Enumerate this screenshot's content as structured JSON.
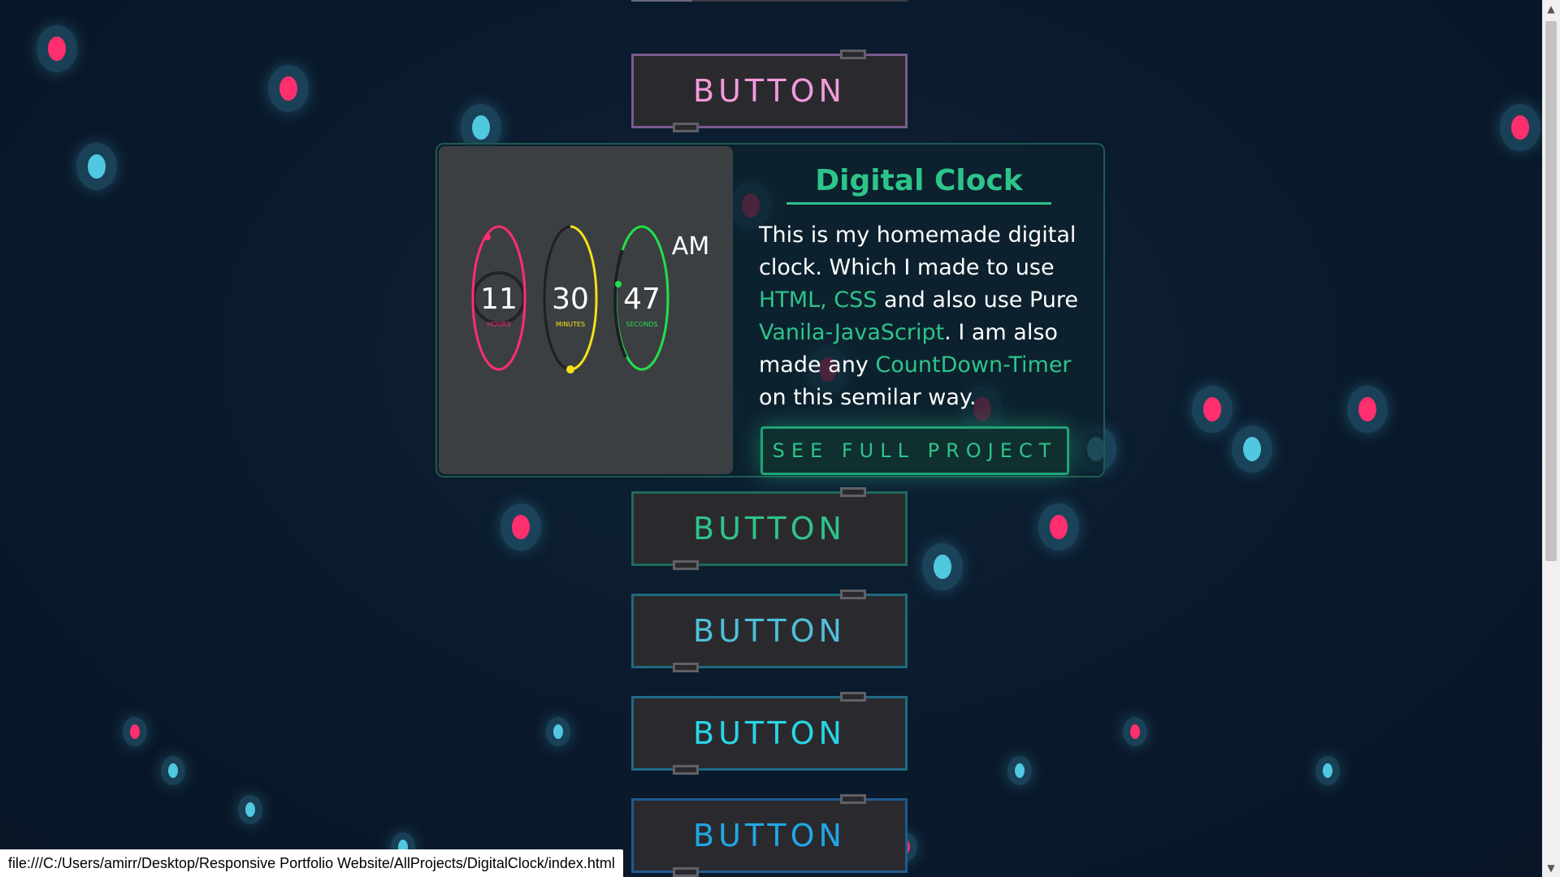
{
  "buttons": [
    {
      "label": "BUTTON"
    },
    {
      "label": "BUTTON"
    },
    {
      "label": "BUTTON"
    },
    {
      "label": "BUTTON"
    },
    {
      "label": "BUTTON"
    }
  ],
  "project": {
    "title": "Digital Clock",
    "desc": {
      "t1": "This is my homemade digital clock. Which I made to use ",
      "h1": "HTML, CSS",
      "t2": " and also use Pure ",
      "h2": "Vanila-JavaScript",
      "t3": ". I am also made any ",
      "h3": "CountDown-Timer",
      "t4": " on this semilar way."
    },
    "cta": "SEE FULL PROJECT",
    "clock": {
      "hours": "11",
      "hours_label": "HOURS",
      "minutes": "30",
      "minutes_label": "MINUTES",
      "seconds": "47",
      "seconds_label": "SECONDS",
      "period": "AM",
      "colors": {
        "hours": "#ff2e6e",
        "minutes": "#f6e21a",
        "seconds": "#22e04a"
      }
    }
  },
  "status_url": "file:///C:/Users/amirr/Desktop/Responsive Portfolio Website/AllProjects/DigitalClock/index.html",
  "colors": {
    "accent": "#2dc48a",
    "pink": "#ff2e6e",
    "cyan": "#4fc8e0"
  }
}
